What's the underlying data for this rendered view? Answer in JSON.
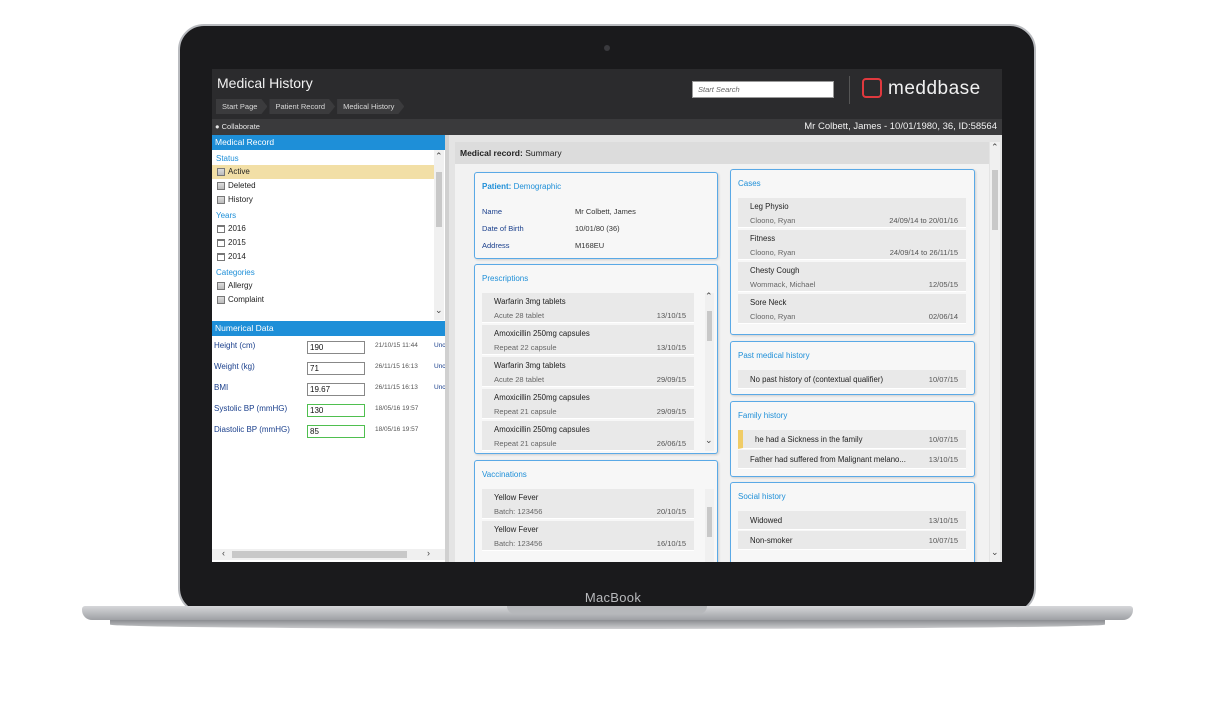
{
  "laptop": {
    "brand": "MacBook"
  },
  "header": {
    "title": "Medical History",
    "breadcrumbs": [
      "Start Page",
      "Patient Record",
      "Medical History"
    ],
    "search_placeholder": "Start Search",
    "logo": "meddbase"
  },
  "subbar": {
    "collaborate": "Collaborate",
    "patient_banner": "Mr Colbett, James - 10/01/1980, 36, ID:58564"
  },
  "medical_record": {
    "heading": "Medical Record",
    "status_label": "Status",
    "status_items": [
      "Active",
      "Deleted",
      "History"
    ],
    "years_label": "Years",
    "years": [
      "2016",
      "2015",
      "2014"
    ],
    "categories_label": "Categories",
    "categories": [
      "Allergy",
      "Complaint"
    ]
  },
  "numerical": {
    "heading": "Numerical Data",
    "rows": [
      {
        "label": "Height (cm)",
        "value": "190",
        "date": "21/10/15 11:44",
        "link": "Unc"
      },
      {
        "label": "Weight (kg)",
        "value": "71",
        "date": "26/11/15 16:13",
        "link": "Unc"
      },
      {
        "label": "BMI",
        "value": "19.67",
        "date": "26/11/15 16:13",
        "link": "Unc"
      },
      {
        "label": "Systolic BP (mmHG)",
        "value": "130",
        "date": "18/05/16 19:57",
        "link": ""
      },
      {
        "label": "Diastolic BP (mmHG)",
        "value": "85",
        "date": "18/05/16 19:57",
        "link": ""
      }
    ]
  },
  "main": {
    "title_bold": "Medical record:",
    "title_rest": "Summary",
    "demographic": {
      "title_bold": "Patient:",
      "title_rest": "Demographic",
      "fields": [
        {
          "key": "Name",
          "value": "Mr Colbett, James"
        },
        {
          "key": "Date of Birth",
          "value": "10/01/80 (36)"
        },
        {
          "key": "Address",
          "value": "M168EU"
        }
      ]
    },
    "prescriptions": {
      "title": "Prescriptions",
      "items": [
        {
          "name": "Warfarin 3mg tablets",
          "detail": "Acute    28 tablet",
          "date": "13/10/15"
        },
        {
          "name": "Amoxicillin 250mg capsules",
          "detail": "Repeat   22 capsule",
          "date": "13/10/15"
        },
        {
          "name": "Warfarin 3mg tablets",
          "detail": "Acute    28 tablet",
          "date": "29/09/15"
        },
        {
          "name": "Amoxicillin 250mg capsules",
          "detail": "Repeat   21 capsule",
          "date": "29/09/15"
        },
        {
          "name": "Amoxicillin 250mg capsules",
          "detail": "Repeat   21 capsule",
          "date": "26/06/15"
        }
      ]
    },
    "vaccinations": {
      "title": "Vaccinations",
      "items": [
        {
          "name": "Yellow Fever",
          "detail": "Batch: 123456",
          "date": "20/10/15"
        },
        {
          "name": "Yellow Fever",
          "detail": "Batch: 123456",
          "date": "16/10/15"
        }
      ]
    },
    "cases": {
      "title": "Cases",
      "items": [
        {
          "name": "Leg Physio",
          "detail": "Cloono, Ryan",
          "date": "24/09/14 to 20/01/16"
        },
        {
          "name": "Fitness",
          "detail": "Cloono, Ryan",
          "date": "24/09/14 to 26/11/15"
        },
        {
          "name": "Chesty Cough",
          "detail": "Wommack, Michael",
          "date": "12/05/15"
        },
        {
          "name": "Sore Neck",
          "detail": "Cloono, Ryan",
          "date": "02/06/14"
        }
      ]
    },
    "past_history": {
      "title": "Past medical history",
      "items": [
        {
          "name": "No past history of (contextual qualifier)",
          "date": "10/07/15"
        }
      ]
    },
    "family_history": {
      "title": "Family history",
      "items": [
        {
          "name": "he had a Sickness in the family",
          "date": "10/07/15"
        },
        {
          "name": "Father had suffered from Malignant melano...",
          "date": "13/10/15"
        }
      ]
    },
    "social_history": {
      "title": "Social history",
      "items": [
        {
          "name": "Widowed",
          "date": "13/10/15"
        },
        {
          "name": "Non-smoker",
          "date": "10/07/15"
        }
      ]
    }
  },
  "colors": {
    "accent": "#1e8fd8",
    "selected": "#f2dfa6",
    "logo": "#e0393e"
  }
}
